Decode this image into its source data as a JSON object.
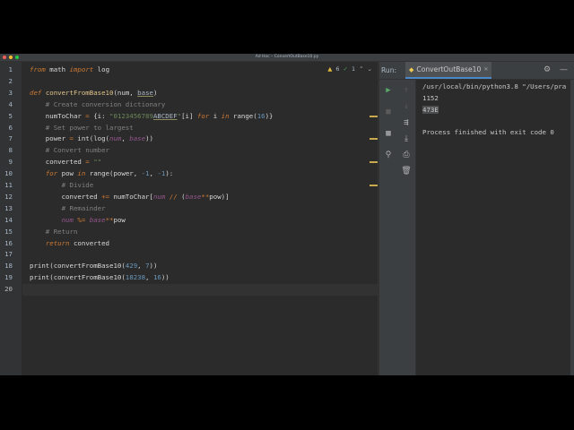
{
  "window": {
    "title": "Ad Hoc – ConvertOutBase10.py",
    "traffic_lights": [
      "#ff5f57",
      "#febc2e",
      "#28c840"
    ]
  },
  "editor": {
    "line_numbers": [
      "1",
      "2",
      "3",
      "4",
      "5",
      "6",
      "7",
      "8",
      "9",
      "10",
      "11",
      "12",
      "13",
      "14",
      "15",
      "16",
      "17",
      "18",
      "19",
      "20"
    ],
    "current_line": 20,
    "inspection": {
      "warning_icon": "warning-triangle-icon",
      "warning_count": "6",
      "check_icon": "check-icon",
      "check_count": "1"
    },
    "lines": [
      [
        [
          "from",
          "t-kw"
        ],
        [
          " math ",
          ""
        ],
        [
          "import",
          "t-kw"
        ],
        [
          " log",
          ""
        ]
      ],
      [],
      [
        [
          "def",
          "t-kw"
        ],
        [
          " ",
          ""
        ],
        [
          "convertFromBase10",
          "t-fn"
        ],
        [
          "(num, ",
          ""
        ],
        [
          "base",
          "t-us"
        ],
        [
          ")",
          ""
        ]
      ],
      [
        [
          "    # Create conversion dictionary",
          "t-cm"
        ]
      ],
      [
        [
          "    numToChar ",
          ""
        ],
        [
          "=",
          "t-op"
        ],
        [
          " {i: ",
          ""
        ],
        [
          "\"0123456789",
          "t-st"
        ],
        [
          "ABCDEF",
          "t-st t-us"
        ],
        [
          "\"",
          "t-st"
        ],
        [
          "[i] ",
          ""
        ],
        [
          "for",
          "t-kw"
        ],
        [
          " i ",
          ""
        ],
        [
          "in",
          "t-kw"
        ],
        [
          " range(",
          ""
        ],
        [
          "16",
          "t-num"
        ],
        [
          ")}",
          ""
        ]
      ],
      [
        [
          "    # Set power to largest",
          "t-cm"
        ]
      ],
      [
        [
          "    power ",
          ""
        ],
        [
          "=",
          "t-op"
        ],
        [
          " int(log(",
          ""
        ],
        [
          "num",
          "t-pr"
        ],
        [
          ", ",
          ""
        ],
        [
          "base",
          "t-pr"
        ],
        [
          "))",
          ""
        ]
      ],
      [
        [
          "    # Convert number",
          "t-cm"
        ]
      ],
      [
        [
          "    converted ",
          ""
        ],
        [
          "=",
          "t-op"
        ],
        [
          " ",
          ""
        ],
        [
          "\"\"",
          "t-st"
        ]
      ],
      [
        [
          "    ",
          ""
        ],
        [
          "for",
          "t-kw"
        ],
        [
          " pow ",
          ""
        ],
        [
          "in",
          "t-kw"
        ],
        [
          " range(power, ",
          ""
        ],
        [
          "-1",
          "t-num"
        ],
        [
          ", ",
          ""
        ],
        [
          "-1",
          "t-num"
        ],
        [
          "):",
          ""
        ]
      ],
      [
        [
          "        # Divide",
          "t-cm"
        ]
      ],
      [
        [
          "        converted ",
          ""
        ],
        [
          "+=",
          "t-op"
        ],
        [
          " numToChar[",
          ""
        ],
        [
          "num",
          "t-pr"
        ],
        [
          " ",
          ""
        ],
        [
          "//",
          "t-op"
        ],
        [
          " (",
          ""
        ],
        [
          "base",
          "t-pr"
        ],
        [
          "**",
          "t-op"
        ],
        [
          "pow)]",
          ""
        ]
      ],
      [
        [
          "        # Remainder",
          "t-cm"
        ]
      ],
      [
        [
          "        ",
          ""
        ],
        [
          "num",
          "t-pr"
        ],
        [
          " ",
          ""
        ],
        [
          "%=",
          "t-op"
        ],
        [
          " ",
          ""
        ],
        [
          "base",
          "t-pr"
        ],
        [
          "**",
          "t-op"
        ],
        [
          "pow",
          ""
        ]
      ],
      [
        [
          "    # Return",
          "t-cm"
        ]
      ],
      [
        [
          "    ",
          ""
        ],
        [
          "return",
          "t-kw"
        ],
        [
          " converted",
          ""
        ]
      ],
      [],
      [
        [
          "print(convertFromBase10(",
          ""
        ],
        [
          "429",
          "t-num"
        ],
        [
          ", ",
          ""
        ],
        [
          "7",
          "t-num"
        ],
        [
          "))",
          ""
        ]
      ],
      [
        [
          "print(convertFromBase10(",
          ""
        ],
        [
          "18238",
          "t-num"
        ],
        [
          ", ",
          ""
        ],
        [
          "16",
          "t-num"
        ],
        [
          "))",
          ""
        ]
      ],
      []
    ],
    "change_markers_on_lines": [
      5,
      7,
      9,
      11
    ]
  },
  "run_panel": {
    "label": "Run:",
    "tab_label": "ConvertOutBase10",
    "tab_icon": "python-icon",
    "gear_icon": "gear-icon",
    "minimize_icon": "minimize-icon",
    "tools_left": [
      {
        "icon": "run-icon",
        "glyph": "▶",
        "color": "#59a869"
      },
      {
        "icon": "stop-icon",
        "glyph": "■",
        "color": "#5a5a5a"
      },
      {
        "icon": "layout-icon",
        "glyph": "▦",
        "color": "#afb1b3"
      },
      {
        "icon": "pin-icon",
        "glyph": "⚲",
        "color": "#afb1b3"
      }
    ],
    "tools_right": [
      {
        "icon": "arrow-up-icon",
        "glyph": "↑",
        "color": "#5a5a5a"
      },
      {
        "icon": "arrow-down-icon",
        "glyph": "↓",
        "color": "#5a5a5a"
      },
      {
        "icon": "soft-wrap-icon",
        "glyph": "⇶",
        "color": "#afb1b3"
      },
      {
        "icon": "scroll-to-end-icon",
        "glyph": "⤓",
        "color": "#afb1b3"
      },
      {
        "icon": "print-icon",
        "glyph": "⎙",
        "color": "#afb1b3"
      },
      {
        "icon": "trash-icon",
        "glyph": "🗑",
        "color": "#afb1b3"
      }
    ],
    "console": [
      "/usr/local/bin/python3.8 \"/Users/pra",
      "1152",
      "473E",
      "",
      "Process finished with exit code 0"
    ]
  }
}
